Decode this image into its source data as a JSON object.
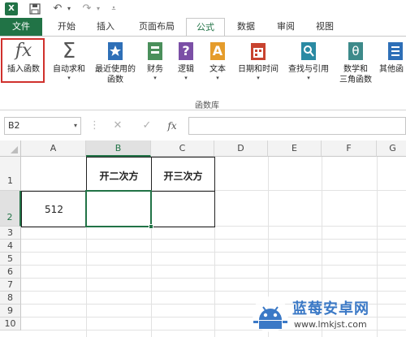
{
  "qat": {
    "app_logo": "X",
    "save_icon": "save-icon",
    "undo_icon": "undo-icon",
    "redo_icon": "redo-icon",
    "customize_icon": "customize-qat-icon"
  },
  "tabs": [
    {
      "label": "文件",
      "active": false
    },
    {
      "label": "开始",
      "active": false
    },
    {
      "label": "插入",
      "active": false
    },
    {
      "label": "页面布局",
      "active": false
    },
    {
      "label": "公式",
      "active": true
    },
    {
      "label": "数据",
      "active": false
    },
    {
      "label": "审阅",
      "active": false
    },
    {
      "label": "视图",
      "active": false
    }
  ],
  "ribbon": {
    "insert_function": {
      "glyph": "fx",
      "label": "插入函数"
    },
    "autosum": {
      "glyph": "Σ",
      "label": "自动求和"
    },
    "recently_used": {
      "label_line1": "最近使用的",
      "label_line2": "函数"
    },
    "financial": {
      "label": "财务"
    },
    "logical": {
      "glyph": "?",
      "label": "逻辑"
    },
    "text": {
      "glyph": "A",
      "label": "文本"
    },
    "date_time": {
      "label": "日期和时间"
    },
    "lookup": {
      "label": "查找与引用"
    },
    "math": {
      "glyph": "θ",
      "label_line1": "数学和",
      "label_line2": "三角函数"
    },
    "other": {
      "label": "其他函"
    },
    "group_label": "函数库"
  },
  "formula_bar": {
    "name_box": "B2",
    "cancel_glyph": "✕",
    "enter_glyph": "✓",
    "fx_glyph": "fx",
    "formula": ""
  },
  "sheet": {
    "columns": [
      "A",
      "B",
      "C",
      "D",
      "E",
      "F",
      "G"
    ],
    "rows": [
      "1",
      "2",
      "3",
      "4",
      "5",
      "6",
      "7",
      "8",
      "9",
      "10"
    ],
    "cells": {
      "B1": "开二次方",
      "C1": "开三次方",
      "A2": "512",
      "B2": "",
      "C2": ""
    },
    "selected_cell": "B2"
  },
  "watermark": {
    "brand": "蓝莓安卓网",
    "url": "www.lmkjst.com"
  },
  "colors": {
    "accent": "#217346",
    "highlight_border": "#d0312d",
    "watermark_blue": "#3b79c6"
  }
}
